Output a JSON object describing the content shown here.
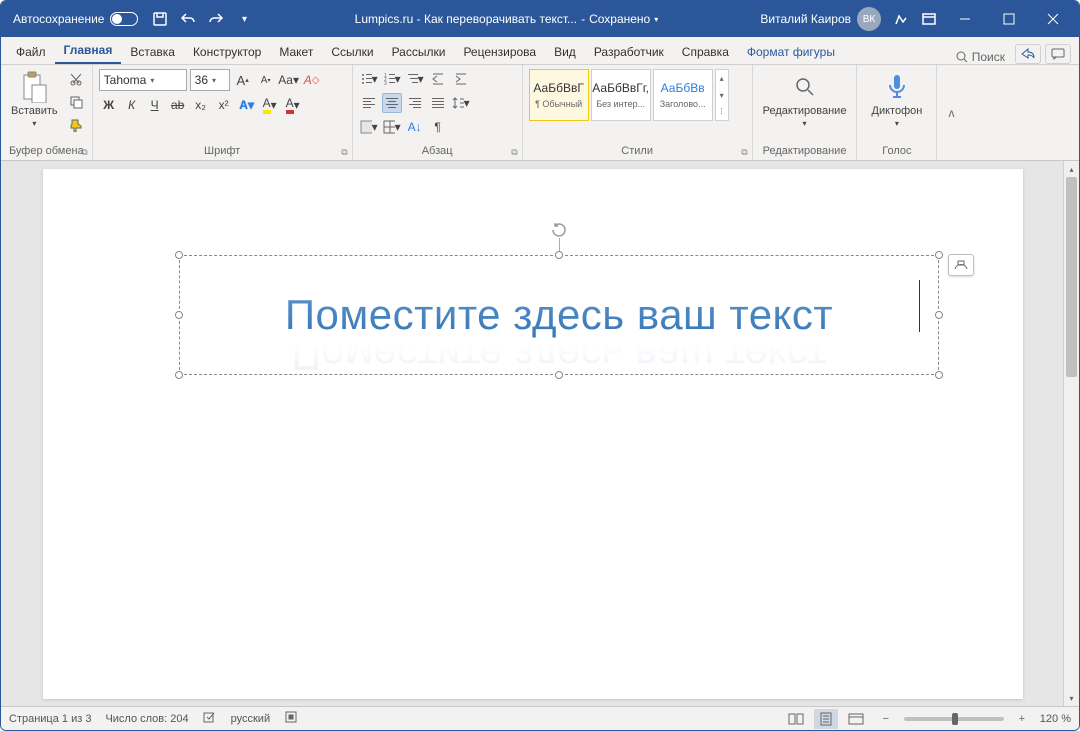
{
  "titlebar": {
    "autosave": "Автосохранение",
    "doc_title": "Lumpics.ru - Как переворачивать текст...",
    "saved": "Сохранено",
    "user_name": "Виталий Каиров",
    "user_initials": "ВК"
  },
  "tabs": {
    "file": "Файл",
    "home": "Главная",
    "insert": "Вставка",
    "design": "Конструктор",
    "layout": "Макет",
    "references": "Ссылки",
    "mailings": "Рассылки",
    "review": "Рецензирова",
    "view": "Вид",
    "developer": "Разработчик",
    "help": "Справка",
    "shape_format": "Формат фигуры",
    "search": "Поиск"
  },
  "ribbon": {
    "clipboard": {
      "paste": "Вставить",
      "label": "Буфер обмена"
    },
    "font": {
      "name": "Tahoma",
      "size": "36",
      "label": "Шрифт",
      "bold": "Ж",
      "italic": "К",
      "underline": "Ч",
      "strike": "ab",
      "sub": "x₂",
      "sup": "x²",
      "effects": "A",
      "highlight": "A",
      "color": "A",
      "case": "Aa",
      "clear": "A"
    },
    "paragraph": {
      "label": "Абзац"
    },
    "styles": {
      "label": "Стили",
      "items": [
        {
          "preview": "АаБбВвГ",
          "name": "¶ Обычный"
        },
        {
          "preview": "АаБбВвГг,",
          "name": "Без интер..."
        },
        {
          "preview": "АаБбВв",
          "name": "Заголово..."
        }
      ]
    },
    "editing": {
      "label": "Редактирование",
      "button": "Редактирование"
    },
    "voice": {
      "label": "Голос",
      "button": "Диктофон"
    }
  },
  "document": {
    "wordart_text": "Поместите здесь ваш текст"
  },
  "status": {
    "page": "Страница 1 из 3",
    "words": "Число слов: 204",
    "lang": "русский",
    "zoom": "120 %"
  }
}
